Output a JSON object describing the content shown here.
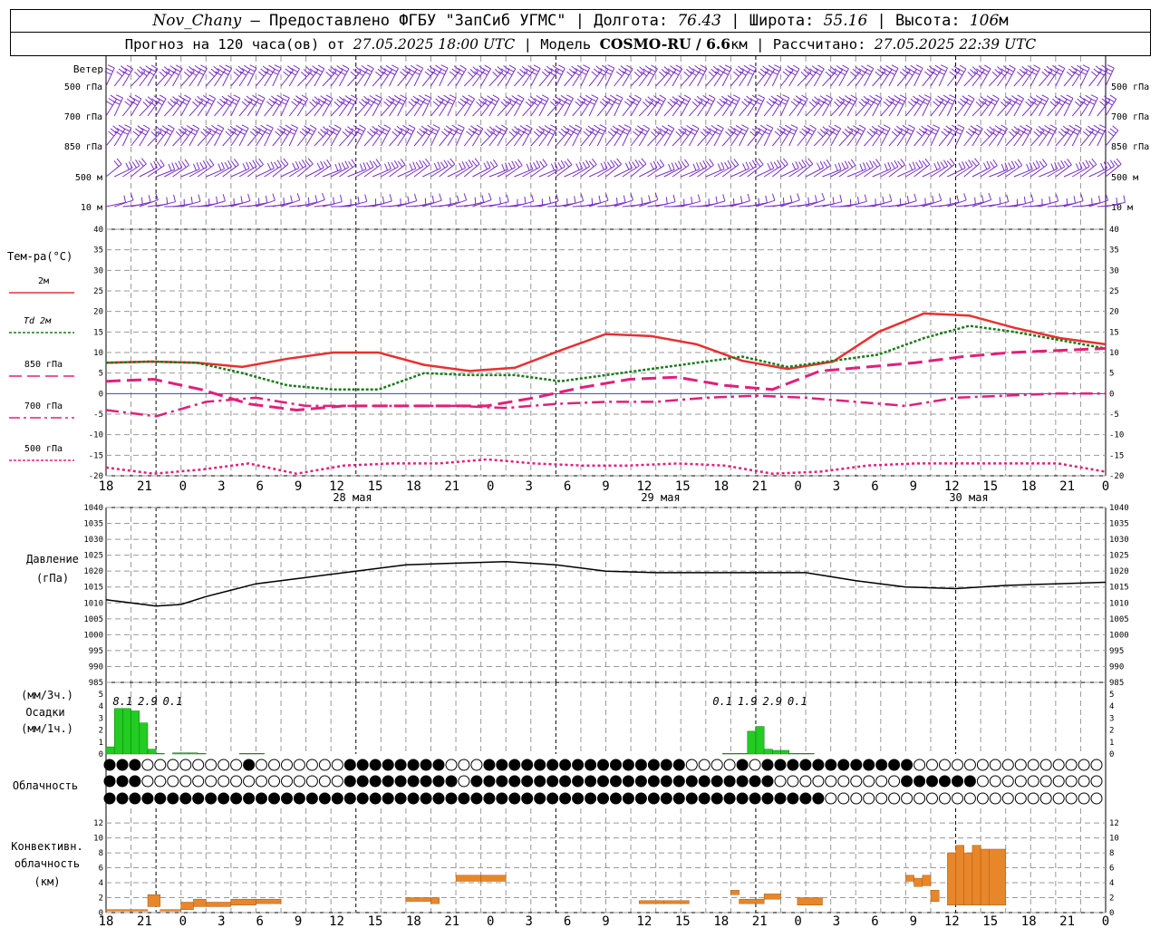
{
  "header": {
    "station": "Nov_Chany",
    "provider": " — Предоставлено ФГБУ \"ЗапСиб УГМС\" | Долгота: ",
    "lon": "76.43",
    "lat_label": " | Широта: ",
    "lat": "55.16",
    "alt_label": " | Высота: ",
    "alt": "106",
    "alt_unit": "м",
    "forecast_label": "Прогноз на 120 часа(ов) от ",
    "forecast_start": "27.05.2025 18:00 UTC",
    "model_label": " | Модель ",
    "model": "COSMO-RU / 6.6",
    "model_unit": "км",
    "computed_label": " | Рассчитано: ",
    "computed": "27.05.2025 22:39 UTC"
  },
  "wind_panel": {
    "title": "Ветер",
    "levels": [
      "500 гПа",
      "700 гПа",
      "850 гПа",
      "500 м",
      "10  м"
    ]
  },
  "temp_panel": {
    "title": "Тем-ра(°C)",
    "legend": [
      {
        "label": "2м",
        "color": "#e83030",
        "style": "solid"
      },
      {
        "label": "Td  2м",
        "color": "#1a7a1a",
        "style": "dotted"
      },
      {
        "label": "850 гПа",
        "color": "#e0207a",
        "style": "dashed"
      },
      {
        "label": "700 гПа",
        "color": "#e0207a",
        "style": "dashdot"
      },
      {
        "label": "500 гПа",
        "color": "#e0207a",
        "style": "dotted"
      }
    ],
    "yticks": [
      "40",
      "35",
      "30",
      "25",
      "20",
      "15",
      "10",
      "5",
      "0",
      "-5",
      "-10",
      "-15",
      "-20"
    ]
  },
  "time_axis": {
    "hours": [
      "18",
      "21",
      "0",
      "3",
      "6",
      "9",
      "12",
      "15",
      "18",
      "21",
      "0",
      "3",
      "6",
      "9",
      "12",
      "15",
      "18",
      "21",
      "0",
      "3",
      "6",
      "9",
      "12",
      "15",
      "18",
      "21",
      "0"
    ],
    "dates": [
      "28 мая",
      "29 мая",
      "30 мая"
    ]
  },
  "pressure_panel": {
    "title": "Давление",
    "unit": "(гПа)",
    "yticks": [
      "1040",
      "1035",
      "1030",
      "1025",
      "1020",
      "1015",
      "1010",
      "1005",
      "1000",
      "995",
      "990",
      "985"
    ]
  },
  "precip_panel": {
    "unit_top": "(мм/3ч.)",
    "title": "Осадки",
    "unit_bottom": "(мм/1ч.)",
    "yticks": [
      "5",
      "4",
      "3",
      "2",
      "1",
      "0"
    ],
    "labels": [
      {
        "text": "8.1",
        "hour": 2
      },
      {
        "text": "2.9",
        "hour": 5
      },
      {
        "text": "0.1",
        "hour": 8
      },
      {
        "text": "0.1",
        "hour": 74
      },
      {
        "text": "1.9",
        "hour": 77
      },
      {
        "text": "2.9",
        "hour": 80
      },
      {
        "text": "0.1",
        "hour": 83
      }
    ]
  },
  "cloud_panel": {
    "title": "Облачность"
  },
  "conv_panel": {
    "title_1": "Конвективн.",
    "title_2": "облачность",
    "unit": "(км)",
    "yticks": [
      "12",
      "10",
      "8",
      "6",
      "4",
      "2",
      "0"
    ]
  },
  "colors": {
    "wind": "#7a30c8",
    "temp2m": "#e83030",
    "dewpoint": "#1a7a1a",
    "upper": "#e0207a",
    "zero_line": "#4040c0",
    "precip": "#22cc22",
    "conv": "#e8862a"
  },
  "chart_data": {
    "type": "line",
    "x_unit": "hours since 27.05.2025 18:00 UTC",
    "temperature": {
      "ylim": [
        -20,
        40
      ],
      "series": [
        {
          "name": "2м",
          "x": [
            0,
            6,
            12,
            18,
            24,
            30,
            36,
            42,
            48,
            54,
            60,
            66,
            72,
            78,
            84,
            90,
            96,
            102,
            108,
            114,
            120
          ],
          "values": [
            7.5,
            7.8,
            7.5,
            6.5,
            8.5,
            10,
            10,
            7,
            5.5,
            6.3,
            10.5,
            14.5,
            14,
            12,
            8,
            6,
            7.8,
            15,
            19.5,
            19,
            16,
            13.5,
            12
          ]
        },
        {
          "name": "Td  2м",
          "x": [
            0,
            6,
            12,
            18,
            24,
            30,
            36,
            42,
            48,
            54,
            60,
            66,
            72,
            78,
            84,
            90,
            96,
            102,
            108,
            114,
            120
          ],
          "values": [
            7.5,
            7.8,
            7.5,
            5,
            2,
            1,
            1,
            5,
            4.5,
            4.5,
            3,
            4.5,
            6,
            7.5,
            9,
            6.5,
            8,
            9.5,
            13.5,
            16.5,
            15,
            13,
            11
          ]
        },
        {
          "name": "850 гПа",
          "x": [
            0,
            6,
            12,
            18,
            24,
            30,
            36,
            42,
            48,
            54,
            60,
            66,
            72,
            78,
            84,
            90,
            96,
            102,
            108,
            114,
            120
          ],
          "values": [
            3,
            3.5,
            1,
            -2.5,
            -4,
            -3,
            -3,
            -3,
            -3,
            -1,
            1.5,
            3.5,
            4,
            2,
            1,
            5.5,
            6.5,
            7.5,
            9,
            10,
            10.5,
            11
          ]
        },
        {
          "name": "700 гПа",
          "x": [
            0,
            6,
            12,
            18,
            24,
            30,
            36,
            42,
            48,
            54,
            60,
            66,
            72,
            78,
            84,
            90,
            96,
            102,
            108,
            114,
            120
          ],
          "values": [
            -4,
            -5.5,
            -2,
            -1,
            -3,
            -3,
            -3,
            -3,
            -3.5,
            -2.5,
            -2,
            -2,
            -1,
            -0.5,
            -1,
            -2,
            -3,
            -1,
            -0.5,
            0,
            0
          ]
        },
        {
          "name": "500 гПа",
          "x": [
            0,
            6,
            12,
            18,
            24,
            30,
            36,
            42,
            48,
            54,
            60,
            66,
            72,
            78,
            84,
            90,
            96,
            102,
            108,
            114,
            120
          ],
          "values": [
            -18,
            -19.5,
            -18.5,
            -17,
            -19.5,
            -17.5,
            -17,
            -17,
            -16,
            -17,
            -17.5,
            -17.5,
            -17,
            -17.5,
            -19.5,
            -19,
            -17.5,
            -17,
            -17,
            -17,
            -17,
            -19
          ]
        }
      ]
    },
    "pressure": {
      "ylim": [
        985,
        1040
      ],
      "x": [
        0,
        3,
        6,
        9,
        12,
        18,
        24,
        30,
        36,
        42,
        48,
        54,
        60,
        66,
        72,
        78,
        84,
        90,
        96,
        102,
        108,
        114,
        120
      ],
      "values": [
        1011,
        1010,
        1009,
        1009.5,
        1012,
        1016,
        1018,
        1020,
        1022,
        1022.5,
        1023,
        1022,
        1020,
        1019.5,
        1019.5,
        1019.5,
        1019.5,
        1017,
        1015,
        1014.5,
        1015.5,
        1016,
        1016.5
      ]
    },
    "precipitation_1h": {
      "ylim": [
        0,
        5
      ],
      "x": [
        0,
        1,
        2,
        3,
        4,
        5,
        6,
        7,
        8,
        9,
        10,
        11,
        16,
        17,
        18,
        19,
        20,
        74,
        75,
        76,
        77,
        78,
        79,
        80,
        81,
        82,
        83,
        84,
        85,
        86
      ],
      "values": [
        0.6,
        3.8,
        3.8,
        3.6,
        2.6,
        0.4,
        0.05,
        0,
        0.1,
        0.1,
        0.1,
        0.05,
        0.05,
        0.05,
        0.05,
        0,
        0,
        0.05,
        0.05,
        0.05,
        1.9,
        2.3,
        0.4,
        0.3,
        0.3,
        0.05,
        0.05,
        0.05,
        0,
        0
      ]
    },
    "cloud_rows": {
      "rows": [
        "FFFEEEEEEEEEEEEEEEEEEEEEEEEEEEEEEEEEEEEEEEEEEEEEEEEEEEEEEEEEEEEEEEEEEEEEEEEEEEEEEEEEEEEEEEEEEEEEEEEEEEEEEEEEEEEEEEEEEEEEE",
        "FFFEEEEEEEEEEEEEEEEEEEEEEEEEEEEEEEEEEEEEEEEEEEEEEEEEEEEEEEEEEEEEEEEEEEEEEEEEEEEEEEEEEEEEEEEEEEEEEEEEEEEEEEEEEEEEEEEEEEEEE",
        "FFFFFFFFFFFFFFFFFFFFFFFFFFFFFFFFFFFFFFFFFFFFFFFFFFFFFFFFFFFFFFFFFFFFFFFFFFFFFFFFFFFFFFFFFFFFFFFFFFFFFFFFFFFFFFFFFFFFFFFFF"
      ]
    },
    "convective_bars": [
      {
        "from": 0,
        "to": 5,
        "base": 0.2,
        "top": 0.4
      },
      {
        "from": 5,
        "to": 6.5,
        "base": 0.8,
        "top": 2.4
      },
      {
        "from": 6.5,
        "to": 9,
        "base": 0.2,
        "top": 0.4
      },
      {
        "from": 9,
        "to": 10.5,
        "base": 0.4,
        "top": 1.4
      },
      {
        "from": 10.5,
        "to": 12,
        "base": 0.8,
        "top": 1.8
      },
      {
        "from": 12,
        "to": 15,
        "base": 0.8,
        "top": 1.4
      },
      {
        "from": 15,
        "to": 18,
        "base": 1.0,
        "top": 1.8
      },
      {
        "from": 18,
        "to": 21,
        "base": 1.2,
        "top": 1.8
      },
      {
        "from": 36,
        "to": 39,
        "base": 1.5,
        "top": 2.0
      },
      {
        "from": 39,
        "to": 40,
        "base": 1.2,
        "top": 2.0
      },
      {
        "from": 42,
        "to": 45,
        "base": 4.2,
        "top": 5.0
      },
      {
        "from": 45,
        "to": 48,
        "base": 4.2,
        "top": 5.0
      },
      {
        "from": 64,
        "to": 67,
        "base": 1.2,
        "top": 1.6
      },
      {
        "from": 67,
        "to": 70,
        "base": 1.2,
        "top": 1.6
      },
      {
        "from": 75,
        "to": 76,
        "base": 2.4,
        "top": 3.0
      },
      {
        "from": 76,
        "to": 79,
        "base": 1.2,
        "top": 1.8
      },
      {
        "from": 79,
        "to": 81,
        "base": 1.8,
        "top": 2.5
      },
      {
        "from": 83,
        "to": 86,
        "base": 1.0,
        "top": 2.0
      },
      {
        "from": 96,
        "to": 97,
        "base": 4.2,
        "top": 5.0
      },
      {
        "from": 97,
        "to": 98,
        "base": 3.5,
        "top": 4.6
      },
      {
        "from": 98,
        "to": 99,
        "base": 3.6,
        "top": 5.0
      },
      {
        "from": 99,
        "to": 100,
        "base": 1.5,
        "top": 3.0
      },
      {
        "from": 101,
        "to": 102,
        "base": 1.0,
        "top": 8.0
      },
      {
        "from": 102,
        "to": 103,
        "base": 1.0,
        "top": 9.0
      },
      {
        "from": 103,
        "to": 104,
        "base": 1.0,
        "top": 8.0
      },
      {
        "from": 104,
        "to": 105,
        "base": 1.0,
        "top": 9.0
      },
      {
        "from": 105,
        "to": 106,
        "base": 1.0,
        "top": 8.5
      },
      {
        "from": 106,
        "to": 108,
        "base": 1.0,
        "top": 8.5
      }
    ]
  }
}
